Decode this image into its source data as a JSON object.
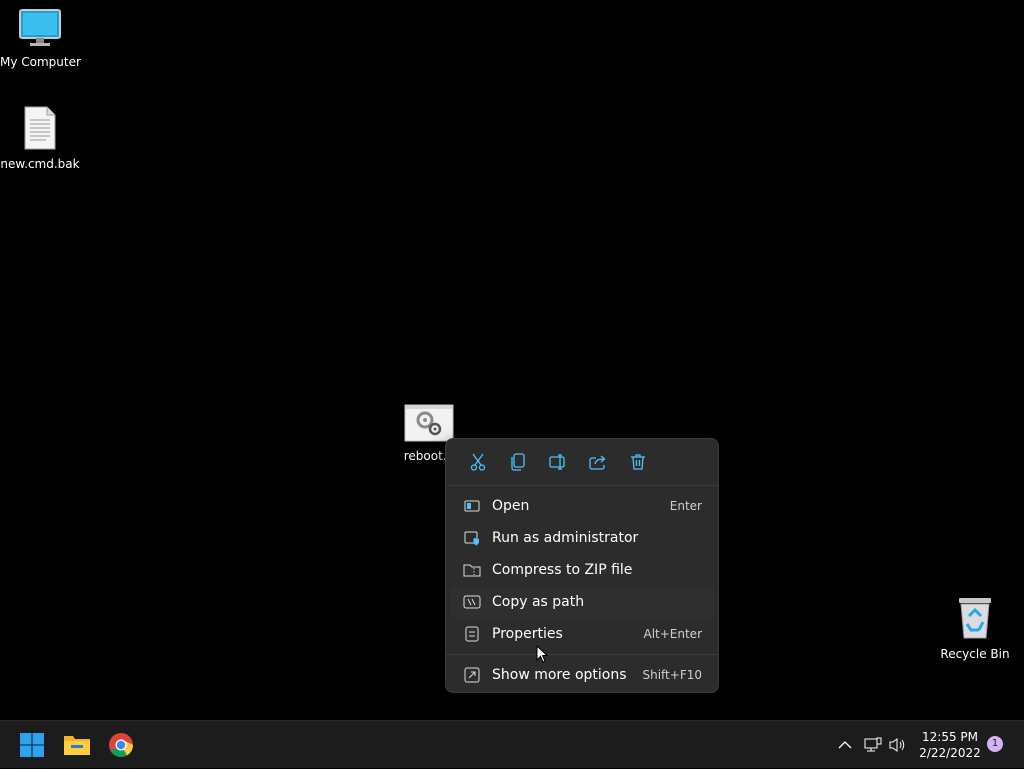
{
  "desktop": {
    "icons": [
      {
        "label": "My Computer"
      },
      {
        "label": "new.cmd.bak"
      },
      {
        "label": "reboot.b"
      },
      {
        "label": "Recycle Bin"
      }
    ]
  },
  "context_menu": {
    "toolbar": [
      "cut-icon",
      "copy-icon",
      "rename-icon",
      "share-icon",
      "delete-icon"
    ],
    "items": [
      {
        "label": "Open",
        "shortcut": "Enter",
        "icon": "open-icon"
      },
      {
        "label": "Run as administrator",
        "shortcut": "",
        "icon": "admin-shield-icon"
      },
      {
        "label": "Compress to ZIP file",
        "shortcut": "",
        "icon": "zip-folder-icon"
      },
      {
        "label": "Copy as path",
        "shortcut": "",
        "icon": "copy-path-icon"
      },
      {
        "label": "Properties",
        "shortcut": "Alt+Enter",
        "icon": "properties-icon"
      },
      {
        "label": "Show more options",
        "shortcut": "Shift+F10",
        "icon": "more-options-icon"
      }
    ]
  },
  "taskbar": {
    "time": "12:55 PM",
    "date": "2/22/2022",
    "notification_count": "1"
  },
  "colors": {
    "accent": "#4cc2ff",
    "menu_bg": "#2c2c2c",
    "taskbar_bg": "#1c1c1c"
  }
}
